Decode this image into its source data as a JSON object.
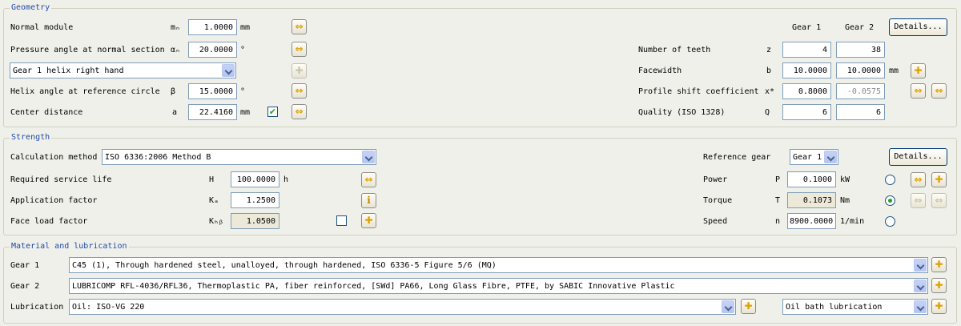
{
  "geometry": {
    "title": "Geometry",
    "normal_module": {
      "label": "Normal module",
      "symbol": "mₙ",
      "value": "1.0000",
      "unit": "mm"
    },
    "pressure_angle": {
      "label": "Pressure angle at normal section",
      "symbol": "αₙ",
      "value": "20.0000",
      "unit": "°"
    },
    "helix_direction": "Gear 1 helix right hand",
    "helix_angle": {
      "label": "Helix angle at reference circle",
      "symbol": "β",
      "value": "15.0000",
      "unit": "°"
    },
    "center_distance": {
      "label": "Center distance",
      "symbol": "a",
      "value": "22.4160",
      "unit": "mm"
    },
    "gear1_header": "Gear 1",
    "gear2_header": "Gear 2",
    "details_label": "Details...",
    "teeth": {
      "label": "Number of teeth",
      "symbol": "z",
      "gear1": "4",
      "gear2": "38"
    },
    "facewidth": {
      "label": "Facewidth",
      "symbol": "b",
      "gear1": "10.0000",
      "gear2": "10.0000",
      "unit": "mm"
    },
    "profile_shift": {
      "label": "Profile shift coefficient",
      "symbol": "x*",
      "gear1": "0.8000",
      "gear2": "-0.0575"
    },
    "quality": {
      "label": "Quality (ISO 1328)",
      "symbol": "Q",
      "gear1": "6",
      "gear2": "6"
    }
  },
  "strength": {
    "title": "Strength",
    "calc_method_label": "Calculation method",
    "calc_method_value": "ISO 6336:2006 Method B",
    "service_life": {
      "label": "Required service life",
      "symbol": "H",
      "value": "100.0000",
      "unit": "h"
    },
    "application_factor": {
      "label": "Application factor",
      "symbol": "Kₐ",
      "value": "1.2500"
    },
    "face_load_factor": {
      "label": "Face load factor",
      "symbol": "Kₕᵦ",
      "value": "1.0500"
    },
    "reference_gear_label": "Reference gear",
    "reference_gear_value": "Gear 1",
    "details_label": "Details...",
    "power": {
      "label": "Power",
      "symbol": "P",
      "value": "0.1000",
      "unit": "kW"
    },
    "torque": {
      "label": "Torque",
      "symbol": "T",
      "value": "0.1073",
      "unit": "Nm"
    },
    "speed": {
      "label": "Speed",
      "symbol": "n",
      "value": "8900.0000",
      "unit": "1/min"
    }
  },
  "material": {
    "title": "Material and lubrication",
    "gear1_label": "Gear 1",
    "gear1_value": "C45 (1), Through hardened steel, unalloyed, through hardened, ISO 6336-5 Figure 5/6 (MQ)",
    "gear2_label": "Gear 2",
    "gear2_value": "LUBRICOMP RFL-4036/RFL36, Thermoplastic PA, fiber reinforced, [SWd] PA66, Long Glass Fibre, PTFE, by SABIC Innovative Plastic",
    "lubrication_label": "Lubrication",
    "lubrication_value": "Oil: ISO-VG 220",
    "lubrication_type": "Oil bath lubrication"
  },
  "icons": {
    "sync": "⇔",
    "plus": "✚",
    "info": "i",
    "check": "✔"
  }
}
